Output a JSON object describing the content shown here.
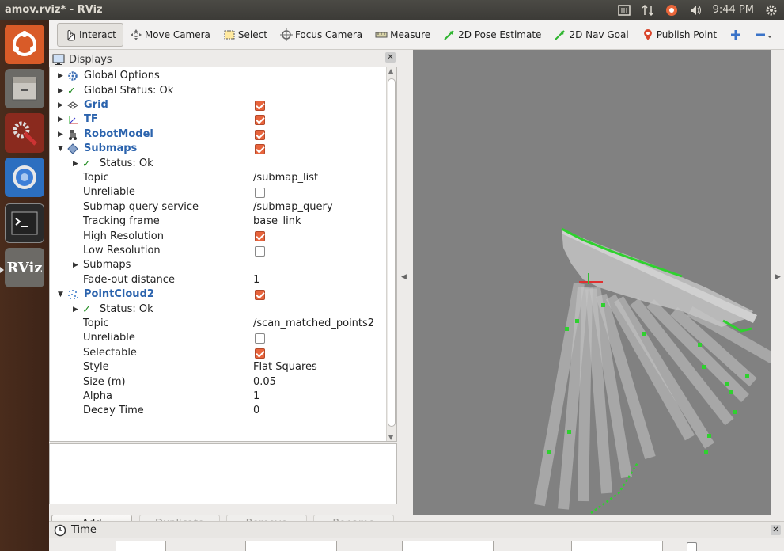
{
  "window": {
    "title": "amov.rviz* - RViz",
    "clock": "9:44 PM"
  },
  "launcher": {
    "items": [
      "ubuntu-logo",
      "files",
      "system-settings",
      "chromium",
      "terminal",
      "rviz"
    ],
    "rviz_label": "RViz"
  },
  "toolbar": {
    "tools": [
      {
        "name": "interact",
        "label": "Interact",
        "active": true
      },
      {
        "name": "move-camera",
        "label": "Move Camera"
      },
      {
        "name": "select",
        "label": "Select"
      },
      {
        "name": "focus-camera",
        "label": "Focus Camera"
      },
      {
        "name": "measure",
        "label": "Measure"
      },
      {
        "name": "2d-pose-estimate",
        "label": "2D Pose Estimate"
      },
      {
        "name": "2d-nav-goal",
        "label": "2D Nav Goal"
      },
      {
        "name": "publish-point",
        "label": "Publish Point"
      }
    ]
  },
  "displays": {
    "title": "Displays",
    "rows": [
      {
        "level": 0,
        "arrow": "▶",
        "icon": "gear",
        "label": "Global Options",
        "value": "",
        "cb": null,
        "style": ""
      },
      {
        "level": 0,
        "arrow": "▶",
        "icon": "check",
        "label": "Global Status: Ok",
        "value": "",
        "cb": null,
        "style": ""
      },
      {
        "level": 0,
        "arrow": "▶",
        "icon": "grid",
        "label": "Grid",
        "value": "",
        "cb": true,
        "style": "blue"
      },
      {
        "level": 0,
        "arrow": "▶",
        "icon": "tf",
        "label": "TF",
        "value": "",
        "cb": true,
        "style": "blue"
      },
      {
        "level": 0,
        "arrow": "▶",
        "icon": "robot",
        "label": "RobotModel",
        "value": "",
        "cb": true,
        "style": "blue"
      },
      {
        "level": 0,
        "arrow": "▼",
        "icon": "submaps",
        "label": "Submaps",
        "value": "",
        "cb": true,
        "style": "blue"
      },
      {
        "level": 1,
        "arrow": "▶",
        "icon": "check",
        "label": "Status: Ok",
        "value": "",
        "cb": null,
        "style": ""
      },
      {
        "level": 1,
        "arrow": "",
        "icon": "",
        "label": "Topic",
        "value": "/submap_list",
        "cb": null,
        "style": ""
      },
      {
        "level": 1,
        "arrow": "",
        "icon": "",
        "label": "Unreliable",
        "value": "",
        "cb": false,
        "style": ""
      },
      {
        "level": 1,
        "arrow": "",
        "icon": "",
        "label": "Submap query service",
        "value": "/submap_query",
        "cb": null,
        "style": ""
      },
      {
        "level": 1,
        "arrow": "",
        "icon": "",
        "label": "Tracking frame",
        "value": "base_link",
        "cb": null,
        "style": ""
      },
      {
        "level": 1,
        "arrow": "",
        "icon": "",
        "label": "High Resolution",
        "value": "",
        "cb": true,
        "style": ""
      },
      {
        "level": 1,
        "arrow": "",
        "icon": "",
        "label": "Low Resolution",
        "value": "",
        "cb": false,
        "style": ""
      },
      {
        "level": 1,
        "arrow": "▶",
        "icon": "",
        "label": "Submaps",
        "value": "",
        "cb": null,
        "style": ""
      },
      {
        "level": 1,
        "arrow": "",
        "icon": "",
        "label": "Fade-out distance",
        "value": "1",
        "cb": null,
        "style": ""
      },
      {
        "level": 0,
        "arrow": "▼",
        "icon": "cloud",
        "label": "PointCloud2",
        "value": "",
        "cb": true,
        "style": "blue"
      },
      {
        "level": 1,
        "arrow": "▶",
        "icon": "check",
        "label": "Status: Ok",
        "value": "",
        "cb": null,
        "style": ""
      },
      {
        "level": 1,
        "arrow": "",
        "icon": "",
        "label": "Topic",
        "value": "/scan_matched_points2",
        "cb": null,
        "style": ""
      },
      {
        "level": 1,
        "arrow": "",
        "icon": "",
        "label": "Unreliable",
        "value": "",
        "cb": false,
        "style": ""
      },
      {
        "level": 1,
        "arrow": "",
        "icon": "",
        "label": "Selectable",
        "value": "",
        "cb": true,
        "style": ""
      },
      {
        "level": 1,
        "arrow": "",
        "icon": "",
        "label": "Style",
        "value": "Flat Squares",
        "cb": null,
        "style": ""
      },
      {
        "level": 1,
        "arrow": "",
        "icon": "",
        "label": "Size (m)",
        "value": "0.05",
        "cb": null,
        "style": ""
      },
      {
        "level": 1,
        "arrow": "",
        "icon": "",
        "label": "Alpha",
        "value": "1",
        "cb": null,
        "style": ""
      },
      {
        "level": 1,
        "arrow": "",
        "icon": "",
        "label": "Decay Time",
        "value": "0",
        "cb": null,
        "style": ""
      }
    ],
    "buttons": [
      {
        "label": "Add",
        "enabled": true
      },
      {
        "label": "Duplicate",
        "enabled": false
      },
      {
        "label": "Remove",
        "enabled": false
      },
      {
        "label": "Rename",
        "enabled": false
      }
    ]
  },
  "time": {
    "title": "Time"
  },
  "colors": {
    "accent_checkbox": "#e8643c",
    "link_blue": "#2b63ad",
    "map_green": "#2fd12f",
    "view_bg": "#818181"
  }
}
